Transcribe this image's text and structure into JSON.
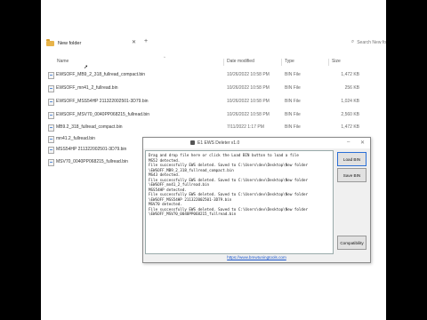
{
  "explorer": {
    "title": "New folder",
    "search_placeholder": "Search New fo",
    "columns": {
      "name": "Name",
      "date": "Date modified",
      "type": "Type",
      "size": "Size"
    },
    "files": [
      {
        "name": "EWSOFF_MB9_2_318_fullread_compact.bin",
        "date": "10/26/2022 10:58 PM",
        "type": "BIN File",
        "size": "1,472 KB"
      },
      {
        "name": "EWSOFF_mn41_2_fullread.bin",
        "date": "10/26/2022 10:58 PM",
        "type": "BIN File",
        "size": "256 KB"
      },
      {
        "name": "EWSOFF_MSS54HP 211322002501-3D79.bin",
        "date": "10/26/2022 10:58 PM",
        "type": "BIN File",
        "size": "1,024 KB"
      },
      {
        "name": "EWSOFF_MSV70_0040PP068215_fullread.bin",
        "date": "10/26/2022 10:58 PM",
        "type": "BIN File",
        "size": "2,560 KB"
      },
      {
        "name": "MB9.2_318_fullread_compact.bin",
        "date": "7/11/2022 1:17 PM",
        "type": "BIN File",
        "size": "1,472 KB"
      },
      {
        "name": "mn41.2_fullread.bin",
        "date": "",
        "type": "",
        "size": ""
      },
      {
        "name": "MSS54HP 211322002501-3D79.bin",
        "date": "",
        "type": "",
        "size": ""
      },
      {
        "name": "MSV70_0040PP068215_fullread.bin",
        "date": "",
        "type": "",
        "size": ""
      }
    ]
  },
  "dialog": {
    "title": "E1 EWS Deleter v1.0",
    "log_lines": [
      "Drag and drop file here or click the Load BIN button to load a file",
      "MS52 detected.",
      "File successfully EWS deleted. Saved to C:\\Users\\dev\\Desktop\\New folder",
      "\\EWSOFF_MB9_2_318_fullread_compact.bin",
      "MS43 detected.",
      "File successfully EWS deleted. Saved to C:\\Users\\dev\\Desktop\\New folder",
      "\\EWSOFF_mn41_2_fullread.bin",
      "MSS54HP detected.",
      "File successfully EWS deleted. Saved to C:\\Users\\dev\\Desktop\\New folder",
      "\\EWSOFF_MSS54HP 211322002501-3D79.bin",
      "MSV70 detected.",
      "File successfully EWS deleted. Saved to C:\\Users\\dev\\Desktop\\New folder",
      "\\EWSOFF_MSV70_0040PP068215_fullread.bin"
    ],
    "buttons": {
      "load": "Load BIN",
      "save": "Save BIN",
      "compat": "Compatibility"
    },
    "link": "https://www.bmwtuningtools.com"
  }
}
